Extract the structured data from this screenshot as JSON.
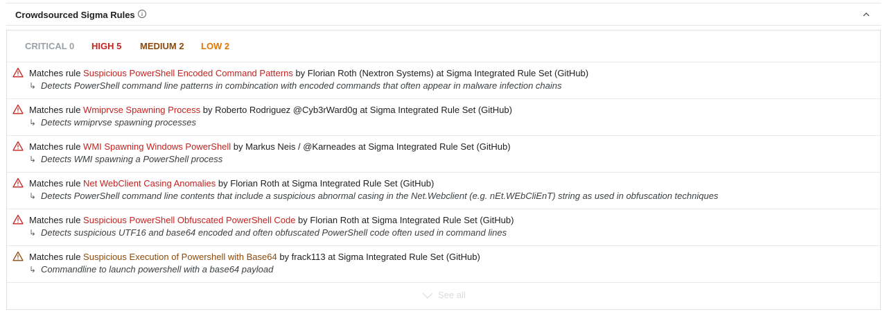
{
  "header": {
    "title": "Crowdsourced Sigma Rules",
    "info_icon": "info-icon",
    "collapse_icon": "chevron-up-icon"
  },
  "severity": {
    "critical": "CRITICAL 0",
    "high": "HIGH 5",
    "medium": "MEDIUM 2",
    "low": "LOW 2"
  },
  "colors": {
    "critical": "#9aa0a6",
    "high": "#c5221f",
    "medium": "#8d4a0b",
    "low": "#e37400"
  },
  "rules": [
    {
      "prefix": "Matches rule ",
      "name": "Suspicious PowerShell Encoded Command Patterns",
      "suffix": " by Florian Roth (Nextron Systems) at Sigma Integrated Rule Set (GitHub)",
      "description": "Detects PowerShell command line patterns in combincation with encoded commands that often appear in malware infection chains",
      "level": "high"
    },
    {
      "prefix": "Matches rule ",
      "name": "Wmiprvse Spawning Process",
      "suffix": " by Roberto Rodriguez @Cyb3rWard0g at Sigma Integrated Rule Set (GitHub)",
      "description": "Detects wmiprvse spawning processes",
      "level": "high"
    },
    {
      "prefix": "Matches rule ",
      "name": "WMI Spawning Windows PowerShell",
      "suffix": " by Markus Neis / @Karneades at Sigma Integrated Rule Set (GitHub)",
      "description": "Detects WMI spawning a PowerShell process",
      "level": "high"
    },
    {
      "prefix": "Matches rule ",
      "name": "Net WebClient Casing Anomalies",
      "suffix": " by Florian Roth at Sigma Integrated Rule Set (GitHub)",
      "description": "Detects PowerShell command line contents that include a suspicious abnormal casing in the Net.Webclient (e.g. nEt.WEbCliEnT) string as used in obfuscation techniques",
      "level": "high"
    },
    {
      "prefix": "Matches rule ",
      "name": "Suspicious PowerShell Obfuscated PowerShell Code",
      "suffix": " by Florian Roth at Sigma Integrated Rule Set (GitHub)",
      "description": "Detects suspicious UTF16 and base64 encoded and often obfuscated PowerShell code often used in command lines",
      "level": "high"
    },
    {
      "prefix": "Matches rule ",
      "name": "Suspicious Execution of Powershell with Base64",
      "suffix": " by frack113 at Sigma Integrated Rule Set (GitHub)",
      "description": "Commandline to launch powershell with a base64 payload",
      "level": "medium"
    }
  ],
  "see_all": "See all"
}
